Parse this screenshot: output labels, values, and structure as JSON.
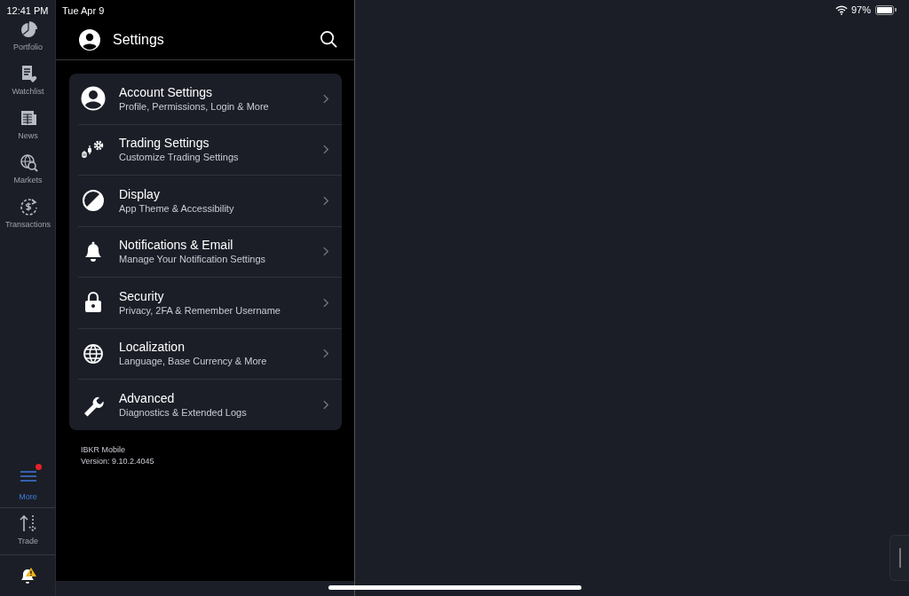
{
  "status_bar": {
    "time": "12:41 PM",
    "date": "Tue Apr 9",
    "battery": "97%"
  },
  "rail": {
    "items": [
      {
        "label": "Portfolio",
        "selected": false
      },
      {
        "label": "Watchlist",
        "selected": false
      },
      {
        "label": "News",
        "selected": false
      },
      {
        "label": "Markets",
        "selected": false
      },
      {
        "label": "Transactions",
        "selected": false
      }
    ],
    "more": {
      "label": "More",
      "selected": true,
      "badge": true
    },
    "trade": {
      "label": "Trade"
    }
  },
  "header": {
    "title": "Settings"
  },
  "settings": [
    {
      "title": "Account Settings",
      "subtitle": "Profile, Permissions, Login & More"
    },
    {
      "title": "Trading Settings",
      "subtitle": "Customize Trading Settings"
    },
    {
      "title": "Display",
      "subtitle": "App Theme & Accessibility"
    },
    {
      "title": "Notifications & Email",
      "subtitle": "Manage Your Notification Settings"
    },
    {
      "title": "Security",
      "subtitle": "Privacy, 2FA & Remember Username"
    },
    {
      "title": "Localization",
      "subtitle": "Language, Base Currency & More"
    },
    {
      "title": "Advanced",
      "subtitle": "Diagnostics & Extended Logs"
    }
  ],
  "footer": {
    "app_name": "IBKR Mobile",
    "version": "Version: 9.10.2.4045"
  }
}
